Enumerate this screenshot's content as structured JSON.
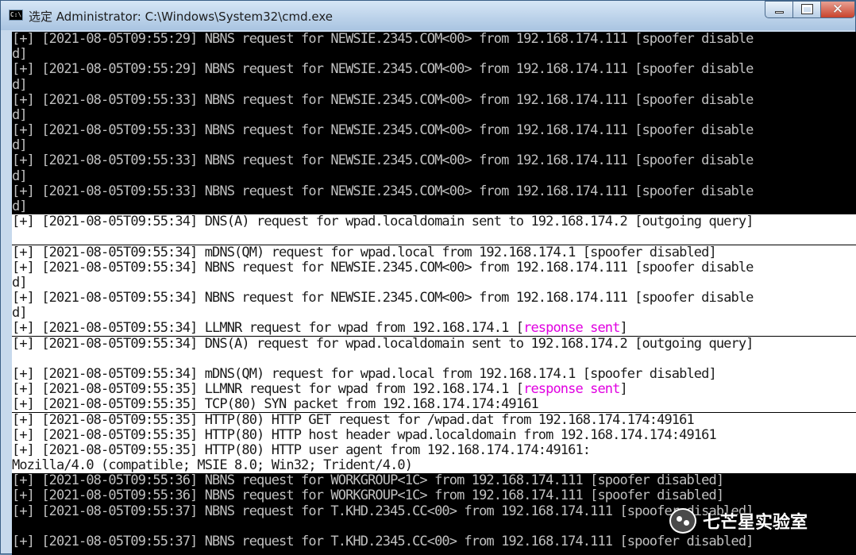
{
  "window": {
    "title": "选定 Administrator: C:\\Windows\\System32\\cmd.exe",
    "icon": "cmd-console-icon",
    "controls": {
      "minimize": "minimize-icon",
      "maximize": "maximize-icon",
      "close": "✕"
    },
    "icon_label": "C:\\"
  },
  "console": {
    "lines": [
      {
        "text": "[+] [2021-08-05T09:55:29] NBNS request for NEWSIE.2345.COM<00> from 192.168.174.111 [spoofer disable",
        "style": "dark"
      },
      {
        "text": "d]",
        "style": "dark"
      },
      {
        "text": "[+] [2021-08-05T09:55:29] NBNS request for NEWSIE.2345.COM<00> from 192.168.174.111 [spoofer disable",
        "style": "dark"
      },
      {
        "text": "d]",
        "style": "dark"
      },
      {
        "text": "[+] [2021-08-05T09:55:33] NBNS request for NEWSIE.2345.COM<00> from 192.168.174.111 [spoofer disable",
        "style": "dark"
      },
      {
        "text": "d]",
        "style": "dark"
      },
      {
        "text": "[+] [2021-08-05T09:55:33] NBNS request for NEWSIE.2345.COM<00> from 192.168.174.111 [spoofer disable",
        "style": "dark"
      },
      {
        "text": "d]",
        "style": "dark"
      },
      {
        "text": "[+] [2021-08-05T09:55:33] NBNS request for NEWSIE.2345.COM<00> from 192.168.174.111 [spoofer disable",
        "style": "dark"
      },
      {
        "text": "d]",
        "style": "dark"
      },
      {
        "text": "[+] [2021-08-05T09:55:33] NBNS request for NEWSIE.2345.COM<00> from 192.168.174.111 [spoofer disable",
        "style": "dark"
      },
      {
        "text": "d]",
        "style": "dark"
      },
      {
        "text": "[+] [2021-08-05T09:55:34] DNS(A) request for wpad.localdomain sent to 192.168.174.2 [outgoing query]",
        "style": "light"
      },
      {
        "text": "",
        "style": "light"
      },
      {
        "text": "[+] [2021-08-05T09:55:34] mDNS(QM) request for wpad.local from 192.168.174.1 [spoofer disabled]",
        "style": "light"
      },
      {
        "text": "[+] [2021-08-05T09:55:34] NBNS request for NEWSIE.2345.COM<00> from 192.168.174.111 [spoofer disable",
        "style": "light"
      },
      {
        "text": "d]",
        "style": "light"
      },
      {
        "text": "[+] [2021-08-05T09:55:34] NBNS request for NEWSIE.2345.COM<00> from 192.168.174.111 [spoofer disable",
        "style": "light"
      },
      {
        "text": "d]",
        "style": "light"
      },
      {
        "text": "[+] [2021-08-05T09:55:34] LLMNR request for wpad from 192.168.174.1 [",
        "highlight": "response sent",
        "suffix": "]",
        "style": "light"
      },
      {
        "text": "[+] [2021-08-05T09:55:34] DNS(A) request for wpad.localdomain sent to 192.168.174.2 [outgoing query]",
        "style": "light"
      },
      {
        "text": "",
        "style": "light"
      },
      {
        "text": "[+] [2021-08-05T09:55:34] mDNS(QM) request for wpad.local from 192.168.174.1 [spoofer disabled]",
        "style": "light"
      },
      {
        "text": "[+] [2021-08-05T09:55:35] LLMNR request for wpad from 192.168.174.1 [",
        "highlight": "response sent",
        "suffix": "]",
        "style": "light"
      },
      {
        "text": "[+] [2021-08-05T09:55:35] TCP(80) SYN packet from 192.168.174.174:49161",
        "style": "light"
      },
      {
        "text": "[+] [2021-08-05T09:55:35] HTTP(80) HTTP GET request for /wpad.dat from 192.168.174.174:49161",
        "style": "light"
      },
      {
        "text": "[+] [2021-08-05T09:55:35] HTTP(80) HTTP host header wpad.localdomain from 192.168.174.174:49161",
        "style": "light"
      },
      {
        "text": "[+] [2021-08-05T09:55:35] HTTP(80) HTTP user agent from 192.168.174.174:49161:",
        "style": "light"
      },
      {
        "text": "Mozilla/4.0 (compatible; MSIE 8.0; Win32; Trident/4.0)",
        "style": "light"
      },
      {
        "text": "[+] [2021-08-05T09:55:36] NBNS request for WORKGROUP<1C> from 192.168.174.111 [spoofer disabled]",
        "style": "dark"
      },
      {
        "text": "[+] [2021-08-05T09:55:36] NBNS request for WORKGROUP<1C> from 192.168.174.111 [spoofer disabled]",
        "style": "dark"
      },
      {
        "text": "[+] [2021-08-05T09:55:37] NBNS request for T.KHD.2345.CC<00> from 192.168.174.111 [spoofer disabled]",
        "style": "dark"
      },
      {
        "text": "",
        "style": "dark"
      },
      {
        "text": "[+] [2021-08-05T09:55:37] NBNS request for T.KHD.2345.CC<00> from 192.168.174.111 [spoofer disabled]",
        "style": "dark"
      }
    ]
  },
  "watermark": {
    "text": "七芒星实验室",
    "icon": "wechat-icon"
  },
  "colors": {
    "console_bg": "#000000",
    "console_fg": "#c0c0c0",
    "selection_bg": "#ffffff",
    "selection_fg": "#1a1a1a",
    "highlight": "#e000e0",
    "close_button": "#c8432c"
  }
}
